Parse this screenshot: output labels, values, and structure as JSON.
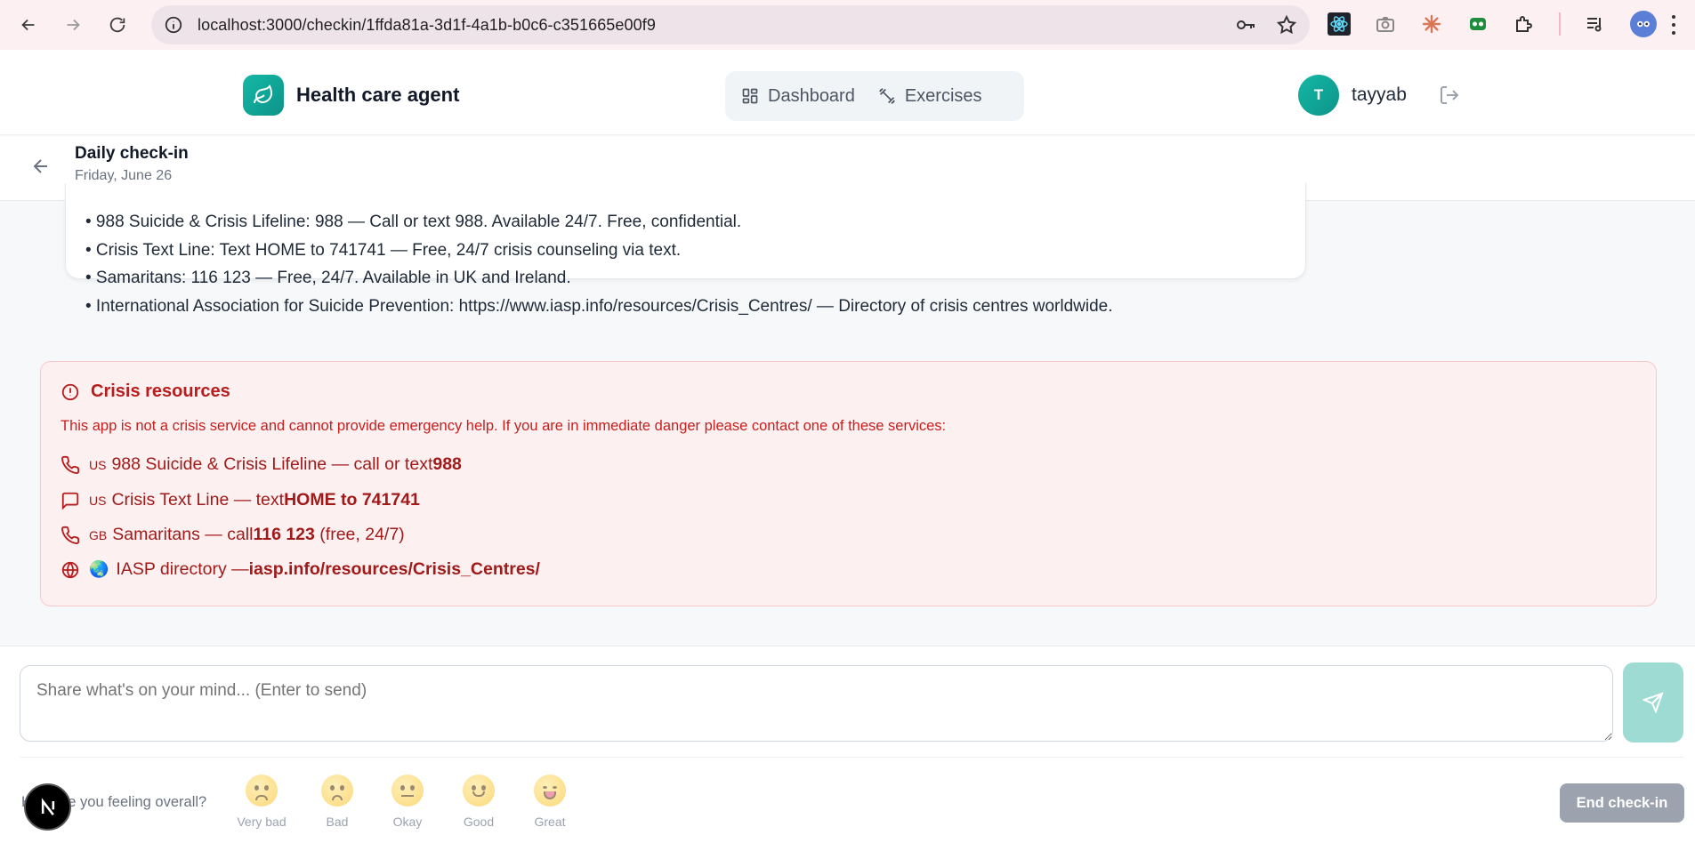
{
  "browser": {
    "url": "localhost:3000/checkin/1ffda81a-3d1f-4a1b-b0c6-c351665e00f9",
    "icons": [
      "back-icon",
      "forward-icon",
      "reload-icon",
      "site-info-icon",
      "password-key-icon",
      "bookmark-star-icon",
      "react-devtools-icon",
      "camera-icon",
      "claude-icon",
      "extension-green-icon",
      "extensions-puzzle-icon",
      "media-queue-icon",
      "profile-avatar-icon",
      "menu-kebab-icon"
    ]
  },
  "header": {
    "brand_name": "Health care agent",
    "nav": [
      {
        "label": "Dashboard",
        "icon": "dashboard-icon"
      },
      {
        "label": "Exercises",
        "icon": "exercises-icon"
      }
    ],
    "user": {
      "initial": "T",
      "name": "tayyab"
    }
  },
  "page": {
    "title": "Daily check-in",
    "date": "Friday, June 26"
  },
  "message": {
    "lines": [
      "• 988 Suicide & Crisis Lifeline: 988 — Call or text 988. Available 24/7. Free, confidential.",
      "• Crisis Text Line: Text HOME to 741741 — Free, 24/7 crisis counseling via text.",
      "• Samaritans: 116 123 — Free, 24/7. Available in UK and Ireland.",
      "• International Association for Suicide Prevention: https://www.iasp.info/resources/Crisis_Centres/ — Directory of crisis centres worldwide."
    ]
  },
  "crisis": {
    "title": "Crisis resources",
    "description": "This app is not a crisis service and cannot provide emergency help. If you are in immediate danger please contact one of these services:",
    "resources": [
      {
        "flag": "US",
        "prefix": "988 Suicide & Crisis Lifeline — call or text ",
        "bold": "988",
        "suffix": "",
        "icon": "phone-icon"
      },
      {
        "flag": "US",
        "prefix": "Crisis Text Line — text ",
        "bold": "HOME to 741741",
        "suffix": "",
        "icon": "message-icon"
      },
      {
        "flag": "GB",
        "prefix": "Samaritans — call ",
        "bold": "116 123",
        "suffix": " (free, 24/7)",
        "icon": "phone-icon"
      },
      {
        "flag": "🌏",
        "prefix": "IASP directory — ",
        "bold": "iasp.info/resources/Crisis_Centres/",
        "suffix": "",
        "icon": "globe-icon"
      }
    ],
    "color": "#b91c1c"
  },
  "composer": {
    "placeholder": "Share what's on your mind... (Enter to send)",
    "mood_question": "How are you feeling overall?",
    "moods": [
      "Very bad",
      "Bad",
      "Okay",
      "Good",
      "Great"
    ],
    "end_button": "End check-in"
  },
  "colors": {
    "accent": "#14b8a6",
    "send_button": "#9ddbd3",
    "crisis_bg": "#fdf0f0"
  }
}
